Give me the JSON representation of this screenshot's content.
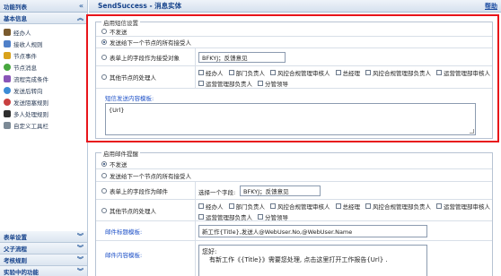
{
  "sidebar": {
    "header": "功能列表",
    "basic_section": "基本信息",
    "items": [
      {
        "label": "经办人",
        "icon": "person-icon",
        "color": "#7a5b2e"
      },
      {
        "label": "接收人规则",
        "icon": "people-icon",
        "color": "#4f80c9"
      },
      {
        "label": "节点事件",
        "icon": "lightning-icon",
        "color": "#d9a21b"
      },
      {
        "label": "节点消息",
        "icon": "message-icon",
        "color": "#47a73f"
      },
      {
        "label": "流程完成条件",
        "icon": "condition-icon",
        "color": "#8a55b8"
      },
      {
        "label": "发送后转向",
        "icon": "redirect-icon",
        "color": "#3c8cd6"
      },
      {
        "label": "发送阻塞规则",
        "icon": "block-icon",
        "color": "#c94040"
      },
      {
        "label": "多人处理规则",
        "icon": "multi-user-icon",
        "color": "#2f2f2f"
      },
      {
        "label": "自定义工具栏",
        "icon": "toolbar-icon",
        "color": "#7c8a96"
      }
    ],
    "sections": [
      {
        "label": "表单设置"
      },
      {
        "label": "父子流程"
      },
      {
        "label": "考核规则"
      },
      {
        "label": "实验中的功能"
      }
    ]
  },
  "topbar": {
    "title": "SendSuccess - 消息实体",
    "help": "帮助"
  },
  "sms": {
    "legend": "启用短信设置",
    "opt_none": "不发送",
    "opt_next": "发送给下一个节点的所有接受人",
    "opt_field": "表单上的字段作为接受对象",
    "field_value": "BFKYJ；反馈意见",
    "opt_other": "其他节点的处理人",
    "checks": [
      "经办人",
      "部门负责人",
      "风控合规管理审核人",
      "总经理",
      "风控合规管理部负责人",
      "运营管理部审核人",
      "运营管理部负责人",
      "分管领导"
    ],
    "template_label": "短信发送内容模板:",
    "template_value": "{Url}"
  },
  "mail": {
    "legend": "启用邮件提醒",
    "opt_none": "不发送",
    "opt_next": "发送给下一个节点的所有接受人",
    "opt_field": "表单上的字段作为邮件",
    "field_prefix": "选择一个字段:",
    "field_value": "BFKYJ；反馈意见",
    "opt_other": "其他节点的处理人",
    "checks": [
      "经办人",
      "部门负责人",
      "风控合规管理审核人",
      "总经理",
      "风控合规管理部负责人",
      "运营管理部审核人",
      "运营管理部负责人",
      "分管领导"
    ],
    "title_label": "邮件标题模板:",
    "title_value": "新工作{Title},发送人@WebUser.No,@WebUser.Name",
    "content_label": "邮件内容模板:",
    "content_line1": "您好:",
    "content_line2": "有新工作《{Title}》需要您处理, 点击这里打开工作报告{Url} ."
  },
  "colors": {
    "accent": "#15428b",
    "highlight": "#e8141a",
    "link": "#1f52c8"
  }
}
